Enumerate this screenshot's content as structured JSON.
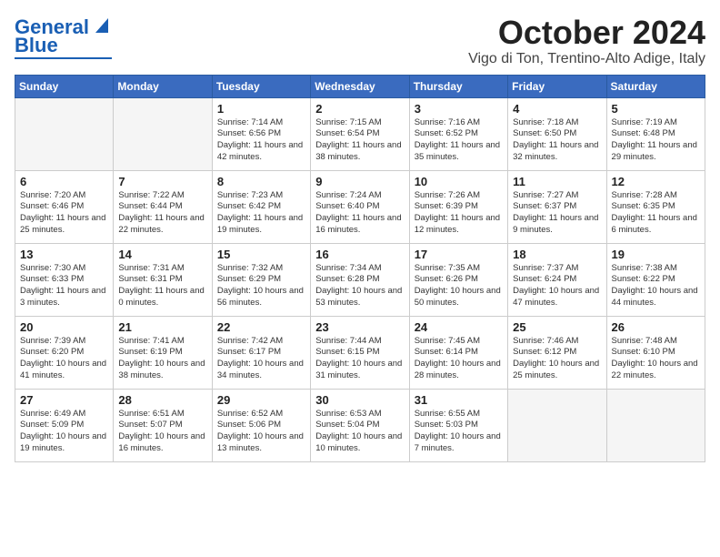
{
  "header": {
    "logo_line1": "General",
    "logo_line2": "Blue",
    "month": "October 2024",
    "location": "Vigo di Ton, Trentino-Alto Adige, Italy"
  },
  "days_of_week": [
    "Sunday",
    "Monday",
    "Tuesday",
    "Wednesday",
    "Thursday",
    "Friday",
    "Saturday"
  ],
  "weeks": [
    [
      {
        "day": "",
        "info": ""
      },
      {
        "day": "",
        "info": ""
      },
      {
        "day": "1",
        "info": "Sunrise: 7:14 AM\nSunset: 6:56 PM\nDaylight: 11 hours and 42 minutes."
      },
      {
        "day": "2",
        "info": "Sunrise: 7:15 AM\nSunset: 6:54 PM\nDaylight: 11 hours and 38 minutes."
      },
      {
        "day": "3",
        "info": "Sunrise: 7:16 AM\nSunset: 6:52 PM\nDaylight: 11 hours and 35 minutes."
      },
      {
        "day": "4",
        "info": "Sunrise: 7:18 AM\nSunset: 6:50 PM\nDaylight: 11 hours and 32 minutes."
      },
      {
        "day": "5",
        "info": "Sunrise: 7:19 AM\nSunset: 6:48 PM\nDaylight: 11 hours and 29 minutes."
      }
    ],
    [
      {
        "day": "6",
        "info": "Sunrise: 7:20 AM\nSunset: 6:46 PM\nDaylight: 11 hours and 25 minutes."
      },
      {
        "day": "7",
        "info": "Sunrise: 7:22 AM\nSunset: 6:44 PM\nDaylight: 11 hours and 22 minutes."
      },
      {
        "day": "8",
        "info": "Sunrise: 7:23 AM\nSunset: 6:42 PM\nDaylight: 11 hours and 19 minutes."
      },
      {
        "day": "9",
        "info": "Sunrise: 7:24 AM\nSunset: 6:40 PM\nDaylight: 11 hours and 16 minutes."
      },
      {
        "day": "10",
        "info": "Sunrise: 7:26 AM\nSunset: 6:39 PM\nDaylight: 11 hours and 12 minutes."
      },
      {
        "day": "11",
        "info": "Sunrise: 7:27 AM\nSunset: 6:37 PM\nDaylight: 11 hours and 9 minutes."
      },
      {
        "day": "12",
        "info": "Sunrise: 7:28 AM\nSunset: 6:35 PM\nDaylight: 11 hours and 6 minutes."
      }
    ],
    [
      {
        "day": "13",
        "info": "Sunrise: 7:30 AM\nSunset: 6:33 PM\nDaylight: 11 hours and 3 minutes."
      },
      {
        "day": "14",
        "info": "Sunrise: 7:31 AM\nSunset: 6:31 PM\nDaylight: 11 hours and 0 minutes."
      },
      {
        "day": "15",
        "info": "Sunrise: 7:32 AM\nSunset: 6:29 PM\nDaylight: 10 hours and 56 minutes."
      },
      {
        "day": "16",
        "info": "Sunrise: 7:34 AM\nSunset: 6:28 PM\nDaylight: 10 hours and 53 minutes."
      },
      {
        "day": "17",
        "info": "Sunrise: 7:35 AM\nSunset: 6:26 PM\nDaylight: 10 hours and 50 minutes."
      },
      {
        "day": "18",
        "info": "Sunrise: 7:37 AM\nSunset: 6:24 PM\nDaylight: 10 hours and 47 minutes."
      },
      {
        "day": "19",
        "info": "Sunrise: 7:38 AM\nSunset: 6:22 PM\nDaylight: 10 hours and 44 minutes."
      }
    ],
    [
      {
        "day": "20",
        "info": "Sunrise: 7:39 AM\nSunset: 6:20 PM\nDaylight: 10 hours and 41 minutes."
      },
      {
        "day": "21",
        "info": "Sunrise: 7:41 AM\nSunset: 6:19 PM\nDaylight: 10 hours and 38 minutes."
      },
      {
        "day": "22",
        "info": "Sunrise: 7:42 AM\nSunset: 6:17 PM\nDaylight: 10 hours and 34 minutes."
      },
      {
        "day": "23",
        "info": "Sunrise: 7:44 AM\nSunset: 6:15 PM\nDaylight: 10 hours and 31 minutes."
      },
      {
        "day": "24",
        "info": "Sunrise: 7:45 AM\nSunset: 6:14 PM\nDaylight: 10 hours and 28 minutes."
      },
      {
        "day": "25",
        "info": "Sunrise: 7:46 AM\nSunset: 6:12 PM\nDaylight: 10 hours and 25 minutes."
      },
      {
        "day": "26",
        "info": "Sunrise: 7:48 AM\nSunset: 6:10 PM\nDaylight: 10 hours and 22 minutes."
      }
    ],
    [
      {
        "day": "27",
        "info": "Sunrise: 6:49 AM\nSunset: 5:09 PM\nDaylight: 10 hours and 19 minutes."
      },
      {
        "day": "28",
        "info": "Sunrise: 6:51 AM\nSunset: 5:07 PM\nDaylight: 10 hours and 16 minutes."
      },
      {
        "day": "29",
        "info": "Sunrise: 6:52 AM\nSunset: 5:06 PM\nDaylight: 10 hours and 13 minutes."
      },
      {
        "day": "30",
        "info": "Sunrise: 6:53 AM\nSunset: 5:04 PM\nDaylight: 10 hours and 10 minutes."
      },
      {
        "day": "31",
        "info": "Sunrise: 6:55 AM\nSunset: 5:03 PM\nDaylight: 10 hours and 7 minutes."
      },
      {
        "day": "",
        "info": ""
      },
      {
        "day": "",
        "info": ""
      }
    ]
  ]
}
